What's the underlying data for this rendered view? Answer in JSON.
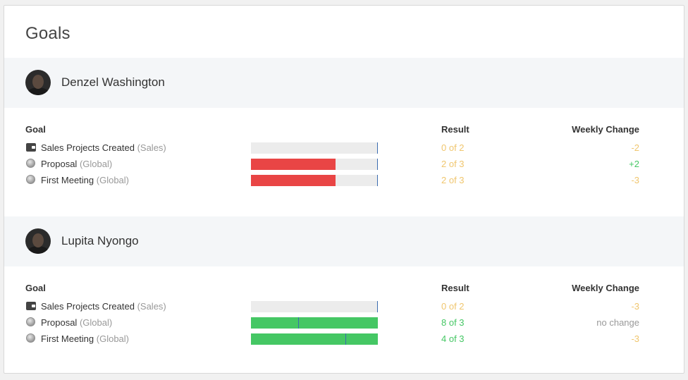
{
  "title": "Goals",
  "columns": {
    "goal": "Goal",
    "result": "Result",
    "weekly": "Weekly Change"
  },
  "colors": {
    "red": "#e94545",
    "green": "#45c764",
    "amber": "#f0c66e",
    "gray": "#999999"
  },
  "people": [
    {
      "name": "Denzel Washington",
      "goals": [
        {
          "label": "Sales Projects Created",
          "scope": "(Sales)",
          "icon": "wallet-icon",
          "progress": 0,
          "target_marker": 1.0,
          "result": "0 of 2",
          "result_color": "amber",
          "weekly": "-2",
          "weekly_color": "amber"
        },
        {
          "label": "Proposal",
          "scope": "(Global)",
          "icon": "globe-icon",
          "progress": 0.667,
          "target_marker": 1.0,
          "result": "2 of 3",
          "result_color": "amber",
          "weekly": "+2",
          "weekly_color": "green"
        },
        {
          "label": "First Meeting",
          "scope": "(Global)",
          "icon": "globe-icon",
          "progress": 0.667,
          "target_marker": 1.0,
          "result": "2 of 3",
          "result_color": "amber",
          "weekly": "-3",
          "weekly_color": "amber"
        }
      ]
    },
    {
      "name": "Lupita Nyongo",
      "goals": [
        {
          "label": "Sales Projects Created",
          "scope": "(Sales)",
          "icon": "wallet-icon",
          "progress": 0,
          "target_marker": 1.0,
          "result": "0 of 2",
          "result_color": "amber",
          "weekly": "-3",
          "weekly_color": "amber"
        },
        {
          "label": "Proposal",
          "scope": "(Global)",
          "icon": "globe-icon",
          "progress": 1.0,
          "target_marker": 0.375,
          "result": "8 of 3",
          "result_color": "green",
          "weekly": "no change",
          "weekly_color": "gray"
        },
        {
          "label": "First Meeting",
          "scope": "(Global)",
          "icon": "globe-icon",
          "progress": 1.0,
          "target_marker": 0.75,
          "result": "4 of 3",
          "result_color": "green",
          "weekly": "-3",
          "weekly_color": "amber"
        }
      ]
    }
  ]
}
